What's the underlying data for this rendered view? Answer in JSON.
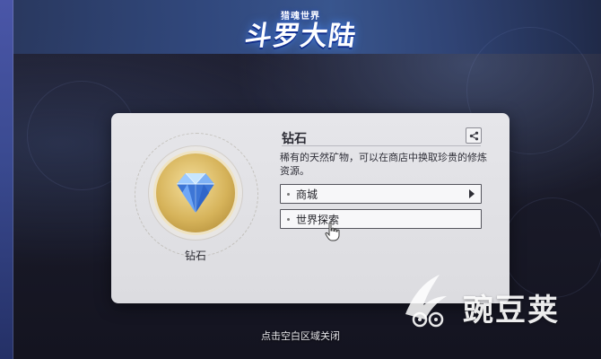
{
  "game": {
    "logo_subtitle": "猎魂世界",
    "logo_title": "斗罗大陆"
  },
  "dialog": {
    "item_icon": "diamond-icon",
    "item_name": "钻石",
    "detail_title": "钻石",
    "share_icon": "share-icon",
    "description": "稀有的天然矿物，可以在商店中换取珍贵的修炼资源。",
    "buttons": [
      {
        "label": "商城",
        "icon": "arrow-right-icon"
      },
      {
        "label": "世界探索"
      }
    ]
  },
  "footer": {
    "close_hint": "点击空白区域关闭"
  },
  "watermark": {
    "text": "豌豆荚",
    "icon": "wandoujia-logo-icon"
  }
}
